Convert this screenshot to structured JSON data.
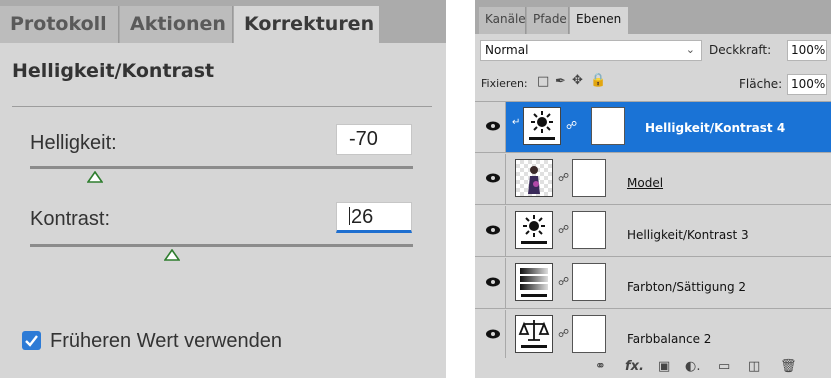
{
  "korrekturen_panel": {
    "tabs": [
      "Protokoll",
      "Aktionen",
      "Korrekturen"
    ],
    "active_tab": "Korrekturen",
    "title": "Helligkeit/Kontrast",
    "brightness": {
      "label": "Helligkeit:",
      "value": "-70",
      "slider_fraction": 0.17
    },
    "contrast": {
      "label": "Kontrast:",
      "value": "26",
      "slider_fraction": 0.37
    },
    "checkbox": {
      "label": "Früheren Wert verwenden",
      "checked": true
    }
  },
  "layers_panel": {
    "tabs": [
      "Kanäle",
      "Pfade",
      "Ebenen"
    ],
    "active_tab": "Ebenen",
    "blend_mode": "Normal",
    "opacity_label": "Deckkraft:",
    "opacity_value": "100%",
    "lock_label": "Fixieren:",
    "fill_label": "Fläche:",
    "fill_value": "100%",
    "layers": [
      {
        "name": "Helligkeit/Kontrast 4",
        "type": "brightness-contrast",
        "selected": true,
        "clipped": true
      },
      {
        "name": "Model",
        "type": "pixel",
        "selected": false
      },
      {
        "name": "Helligkeit/Kontrast 3",
        "type": "brightness-contrast",
        "selected": false
      },
      {
        "name": "Farbton/Sättigung 2",
        "type": "hue-saturation",
        "selected": false
      },
      {
        "name": "Farbbalance 2",
        "type": "color-balance",
        "selected": false
      }
    ],
    "footer_icons": [
      "link-icon",
      "fx-icon",
      "mask-icon",
      "adjustment-icon",
      "folder-icon",
      "new-layer-icon",
      "trash-icon"
    ]
  },
  "colors": {
    "accent": "#1a73d6",
    "panel_bg": "#d6d6d6"
  }
}
